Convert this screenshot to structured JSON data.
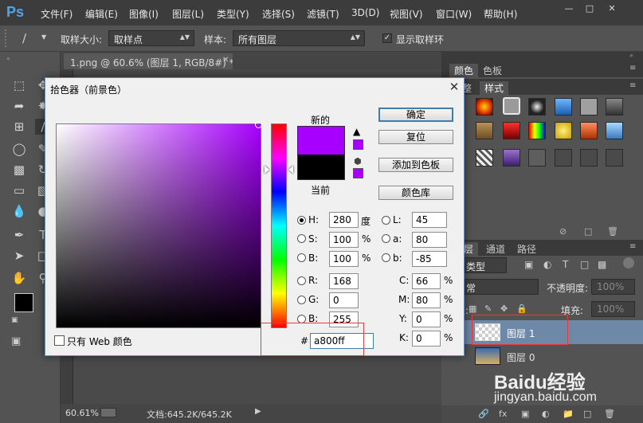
{
  "app": {
    "logo": "Ps"
  },
  "menubar": {
    "items": [
      "文件(F)",
      "编辑(E)",
      "图像(I)",
      "图层(L)",
      "类型(Y)",
      "选择(S)",
      "滤镜(T)",
      "3D(D)",
      "视图(V)",
      "窗口(W)",
      "帮助(H)"
    ]
  },
  "options": {
    "sample_size_label": "取样大小:",
    "sample_size_value": "取样点",
    "sample_label": "样本:",
    "sample_value": "所有图层",
    "show_ring_label": "显示取样环"
  },
  "document": {
    "tab_title": "1.png @ 60.6% (图层 1, RGB/8#) *",
    "zoom": "60.61%",
    "doc_info": "文档:645.2K/645.2K"
  },
  "panels": {
    "color_tabs": [
      "颜色",
      "色板"
    ],
    "style_tabs": [
      "整",
      "样式"
    ],
    "layer_tabs": [
      "层",
      "通道",
      "路径"
    ],
    "kind_filter": "类型",
    "blend_mode": "常",
    "opacity_label": "不透明度:",
    "opacity_value": "100%",
    "fill_label": "填充:",
    "fill_value": "100%",
    "lock_label": "定:",
    "layers": [
      "图层 1",
      "图层 0"
    ]
  },
  "dialog": {
    "title": "拾色器（前景色）",
    "new_label": "新的",
    "current_label": "当前",
    "buttons": {
      "ok": "确定",
      "reset": "复位",
      "add_to_swatches": "添加到色板",
      "color_libraries": "颜色库"
    },
    "hsb": {
      "h_label": "H:",
      "h": "280",
      "h_unit": "度",
      "s_label": "S:",
      "s": "100",
      "s_unit": "%",
      "b_label": "B:",
      "b": "100",
      "b_unit": "%"
    },
    "lab": {
      "l_label": "L:",
      "l": "45",
      "a_label": "a:",
      "a": "80",
      "b_label": "b:",
      "b": "-85"
    },
    "rgb": {
      "r_label": "R:",
      "r": "168",
      "g_label": "G:",
      "g": "0",
      "b_label": "B:",
      "b": "255"
    },
    "cmyk": {
      "c_label": "C:",
      "c": "66",
      "m_label": "M:",
      "m": "80",
      "y_label": "Y:",
      "y": "0",
      "k_label": "K:",
      "k": "0",
      "unit": "%"
    },
    "hex_label": "#",
    "hex": "a800ff",
    "web_only_label": "只有 Web 颜色"
  },
  "colors": {
    "new_color": "#a800ff",
    "current_color": "#000000",
    "accent": "#3c7fb1",
    "highlight": "#e53b3b"
  },
  "watermark": {
    "logo": "Baidu经验",
    "url": "jingyan.baidu.com"
  }
}
